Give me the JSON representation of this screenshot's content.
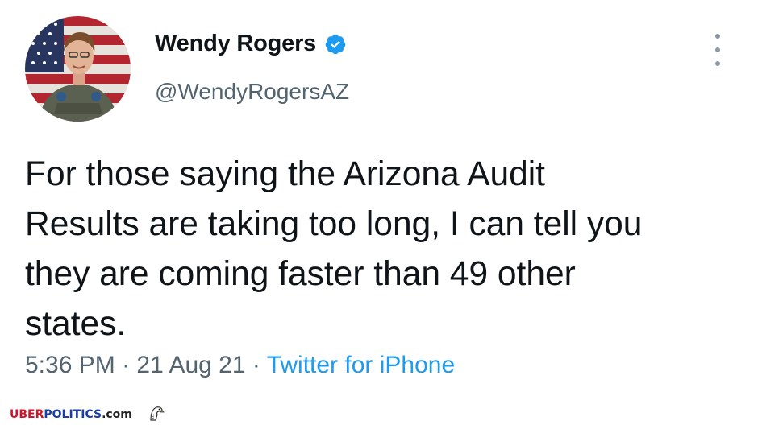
{
  "author": {
    "display_name": "Wendy Rogers",
    "handle": "@WendyRogersAZ",
    "avatar_icon": "profile-photo",
    "verified_icon": "verified-badge-icon",
    "verified_color": "#1d9bf0"
  },
  "tweet": {
    "text": "For those saying the Arizona Audit\nResults are taking too long, I can tell you\nthey are coming faster than 49 other\nstates.",
    "time": "5:36 PM",
    "date": "21 Aug 21",
    "separator": "·",
    "source": "Twitter for iPhone"
  },
  "menu": {
    "icon": "more-vertical-icon"
  },
  "watermark": {
    "uber": "UBER",
    "politics": "POLITICS",
    "dotcom": ".com",
    "logo_icon": "eagle-icon"
  },
  "colors": {
    "text": "#0f1419",
    "secondary": "#536471",
    "link": "#1d9bf0"
  }
}
